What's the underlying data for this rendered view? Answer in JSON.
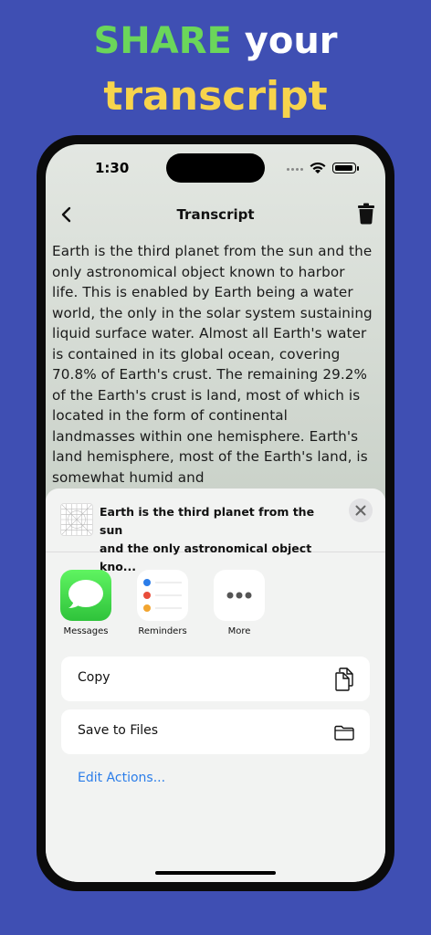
{
  "promo": {
    "word_share": "SHARE",
    "word_your": "your",
    "word_transcript": "transcript"
  },
  "status_bar": {
    "time": "1:30"
  },
  "nav": {
    "title": "Transcript",
    "back_icon": "chevron-left-icon",
    "trash_icon": "trash-icon"
  },
  "transcript": {
    "text": "Earth is the third planet from the sun and the only astronomical object known to harbor life. This is enabled by Earth being a water world, the only in the solar system sustaining liquid surface water. Almost all Earth's water is contained in its global ocean, covering 70.8% of Earth's crust. The remaining 29.2% of the Earth's crust is land, most of which is located in the form of continental landmasses within one hemisphere. Earth's land hemisphere, most of the Earth's land, is somewhat humid and"
  },
  "share_sheet": {
    "preview_line1": "Earth is the third planet from the sun",
    "preview_line2": "and the only astronomical object kno...",
    "apps": [
      {
        "label": "Messages"
      },
      {
        "label": "Reminders"
      },
      {
        "label": "More"
      }
    ],
    "actions": {
      "copy": "Copy",
      "save_to_files": "Save to Files"
    },
    "edit_actions": "Edit Actions..."
  },
  "colors": {
    "background": "#3f4fb3",
    "share_green": "#6bd65a",
    "transcript_yellow": "#f7d44c",
    "link_blue": "#2b7de9"
  }
}
